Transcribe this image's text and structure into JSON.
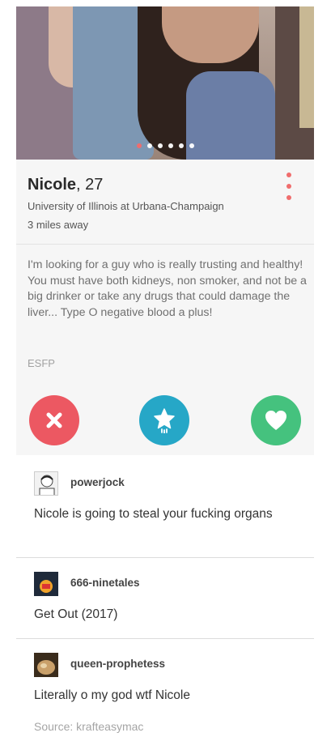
{
  "profile": {
    "name": "Nicole",
    "age": ", 27",
    "school": "University of Illinois at Urbana-Champaign",
    "distance": "3 miles away",
    "bio": "I'm looking for a guy who is really trusting and healthy! You must have both kidneys, non smoker, and not be a big drinker or take any drugs that could damage the liver... Type O negative blood a plus!",
    "personality": "ESFP",
    "photo_count": 6,
    "active_photo": 1
  },
  "actions": {
    "nope_icon": "x-icon",
    "super_like_icon": "star-icon",
    "like_icon": "heart-icon"
  },
  "comments": [
    {
      "user": "powerjock",
      "text": "Nicole is going to steal your fucking organs"
    },
    {
      "user": "666-ninetales",
      "text": "Get Out (2017)"
    },
    {
      "user": "queen-prophetess",
      "text": "Literally o my god wtf Nicole"
    }
  ],
  "source": "Source: krafteasymac",
  "colors": {
    "nope": "#ec5862",
    "super_like": "#26a7c7",
    "like": "#45c27e",
    "accent": "#f06d6d"
  }
}
